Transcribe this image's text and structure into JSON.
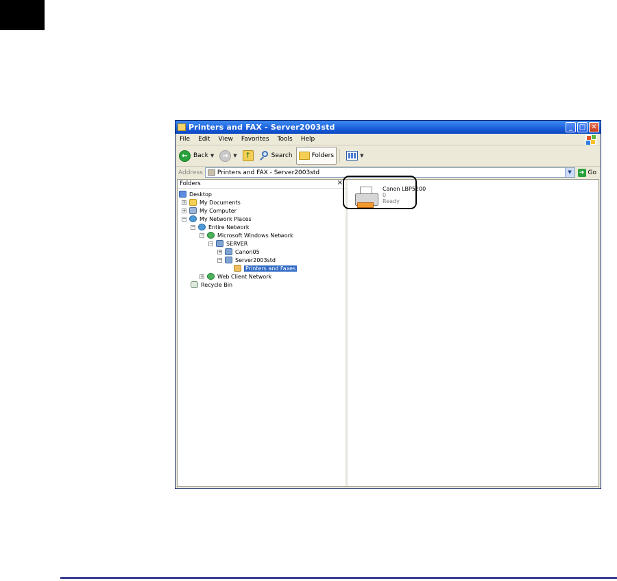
{
  "window": {
    "title": "Printers and FAX - Server2003std"
  },
  "menu": {
    "items": [
      "File",
      "Edit",
      "View",
      "Favorites",
      "Tools",
      "Help"
    ]
  },
  "toolbar": {
    "back_label": "Back",
    "search_label": "Search",
    "folders_label": "Folders"
  },
  "address": {
    "label": "Address",
    "value": "Printers and FAX - Server2003std",
    "go_label": "Go"
  },
  "folders_pane": {
    "title": "Folders",
    "close_glyph": "×",
    "tree": [
      {
        "label": "Desktop",
        "expander": "",
        "icon": "desktop-icon"
      },
      {
        "label": "My Documents",
        "expander": "+",
        "icon": "my-documents-icon"
      },
      {
        "label": "My Computer",
        "expander": "+",
        "icon": "my-computer-icon"
      },
      {
        "label": "My Network Places",
        "expander": "−",
        "icon": "network-places-icon"
      },
      {
        "label": "Entire Network",
        "expander": "−",
        "icon": "entire-network-icon"
      },
      {
        "label": "Microsoft Windows Network",
        "expander": "−",
        "icon": "windows-network-icon"
      },
      {
        "label": "SERVER",
        "expander": "−",
        "icon": "workgroup-icon"
      },
      {
        "label": "Canon05",
        "expander": "+",
        "icon": "computer-icon"
      },
      {
        "label": "Server2003std",
        "expander": "−",
        "icon": "computer-icon"
      },
      {
        "label": "Printers and Faxes",
        "expander": "",
        "icon": "printers-folder-icon",
        "selected": true
      },
      {
        "label": "Web Client Network",
        "expander": "+",
        "icon": "web-client-icon"
      },
      {
        "label": "Recycle Bin",
        "expander": "",
        "icon": "recycle-bin-icon"
      }
    ]
  },
  "printer": {
    "name": "Canon LBP5200",
    "jobs": "0",
    "status": "Ready"
  },
  "colors": {
    "titlebar": "#1b5fd8",
    "selection": "#316ac5",
    "bottom_rule": "#3a3f8f"
  }
}
